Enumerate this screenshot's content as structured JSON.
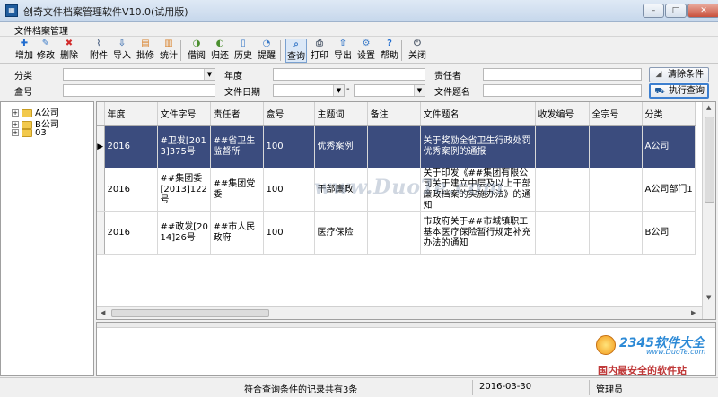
{
  "window": {
    "title": "创奇文件档案管理软件V10.0(试用版)",
    "min": "–",
    "max": "□",
    "close": "✕"
  },
  "menu": {
    "item": "文件档案管理"
  },
  "toolbar": [
    {
      "label": "增加",
      "icon": "plus-icon",
      "color": "#1f6ccf",
      "glyph": "✚"
    },
    {
      "label": "修改",
      "icon": "edit-icon",
      "color": "#3a7ac8",
      "glyph": "✎"
    },
    {
      "label": "删除",
      "icon": "delete-icon",
      "color": "#d22b2b",
      "glyph": "✖"
    },
    {
      "label": "附件",
      "icon": "paperclip-icon",
      "color": "#5b6e8c",
      "glyph": "⌇"
    },
    {
      "label": "导入",
      "icon": "import-icon",
      "color": "#4d7bb5",
      "glyph": "⇩"
    },
    {
      "label": "批修",
      "icon": "batch-edit-icon",
      "color": "#d9822b",
      "glyph": "▤"
    },
    {
      "label": "统计",
      "icon": "statistics-icon",
      "color": "#d9822b",
      "glyph": "▥"
    },
    {
      "label": "借阅",
      "icon": "borrow-icon",
      "color": "#4b8f2f",
      "glyph": "◑"
    },
    {
      "label": "归还",
      "icon": "return-icon",
      "color": "#4b8f2f",
      "glyph": "◐"
    },
    {
      "label": "历史",
      "icon": "history-icon",
      "color": "#3a7ac8",
      "glyph": "▯"
    },
    {
      "label": "提醒",
      "icon": "reminder-icon",
      "color": "#3a7ac8",
      "glyph": "◔"
    },
    {
      "label": "查询",
      "icon": "search-icon",
      "color": "#3a7ac8",
      "glyph": "⌕"
    },
    {
      "label": "打印",
      "icon": "print-icon",
      "color": "#556070",
      "glyph": "⎙"
    },
    {
      "label": "导出",
      "icon": "export-icon",
      "color": "#3a7ac8",
      "glyph": "⇧"
    },
    {
      "label": "设置",
      "icon": "gear-icon",
      "color": "#3a7ac8",
      "glyph": "⚙"
    },
    {
      "label": "帮助",
      "icon": "help-icon",
      "color": "#1f6ccf",
      "glyph": "?"
    },
    {
      "label": "关闭",
      "icon": "exit-icon",
      "color": "#556070",
      "glyph": "⏻"
    }
  ],
  "filters": {
    "category": "分类",
    "year": "年度",
    "responsible": "责任者",
    "box": "盒号",
    "file_date": "文件日期",
    "date_sep": "-",
    "file_title": "文件题名",
    "clear_button": "清除条件",
    "search_button": "执行查询"
  },
  "tree": [
    {
      "label": "A公司"
    },
    {
      "label": "B公司"
    },
    {
      "label": "03"
    }
  ],
  "table": {
    "columns": [
      "年度",
      "文件字号",
      "责任者",
      "盒号",
      "主题词",
      "备注",
      "文件题名",
      "收发编号",
      "全宗号",
      "分类"
    ],
    "rows": [
      [
        "2016",
        "#卫发[2013]375号",
        "##省卫生监督所",
        "100",
        "优秀案例",
        "",
        "关于奖励全省卫生行政处罚优秀案例的通报",
        "",
        "",
        "A公司"
      ],
      [
        "2016",
        "##集团委[2013]122号",
        "##集团党委",
        "100",
        "干部廉政",
        "",
        "关于印发《##集团有限公司关于建立中层及以上干部廉政档案的实施办法》的通知",
        "",
        "",
        "A公司部门1"
      ],
      [
        "2016",
        "##政发[2014]26号",
        "##市人民政府",
        "100",
        "医疗保险",
        "",
        "市政府关于##市城镇职工基本医疗保险暂行规定补充办法的通知",
        "",
        "",
        "B公司"
      ]
    ],
    "selected_marker": "▶"
  },
  "watermark": "www.DuoTe.com",
  "brand": {
    "name": "2345软件大全",
    "url": "www.DuoTe.com",
    "slogan": "国内最安全的软件站"
  },
  "status": {
    "record_count": "符合查询条件的记录共有3条",
    "date": "2016-03-30",
    "user": "管理员"
  }
}
